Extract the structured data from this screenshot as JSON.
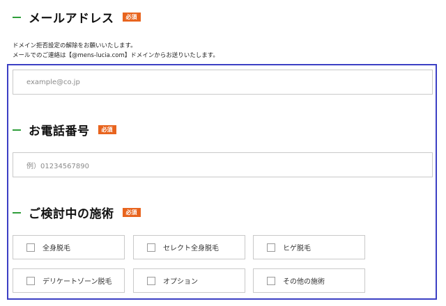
{
  "email_section": {
    "heading": "メールアドレス",
    "required_badge": "必須",
    "note_line1": "ドメイン拒否設定の解除をお願いいたします。",
    "note_line2": "メールでのご連絡は【@mens-lucia.com】ドメインからお送りいたします。",
    "placeholder": "example@co.jp"
  },
  "phone_section": {
    "heading": "お電話番号",
    "required_badge": "必須",
    "placeholder": "例）01234567890"
  },
  "treatment_section": {
    "heading": "ご検討中の施術",
    "required_badge": "必須",
    "options": [
      {
        "label": "全身脱毛",
        "checked": false
      },
      {
        "label": "セレクト全身脱毛",
        "checked": false
      },
      {
        "label": "ヒゲ脱毛",
        "checked": false
      },
      {
        "label": "デリケートゾーン脱毛",
        "checked": false
      },
      {
        "label": "オプション",
        "checked": false
      },
      {
        "label": "その他の施術",
        "checked": false
      }
    ]
  },
  "colors": {
    "accent_green": "#2e9e3a",
    "required_badge_orange": "#e8641e",
    "highlight_frame_blue": "#3b3fc4",
    "field_border": "#c9c9c9"
  }
}
